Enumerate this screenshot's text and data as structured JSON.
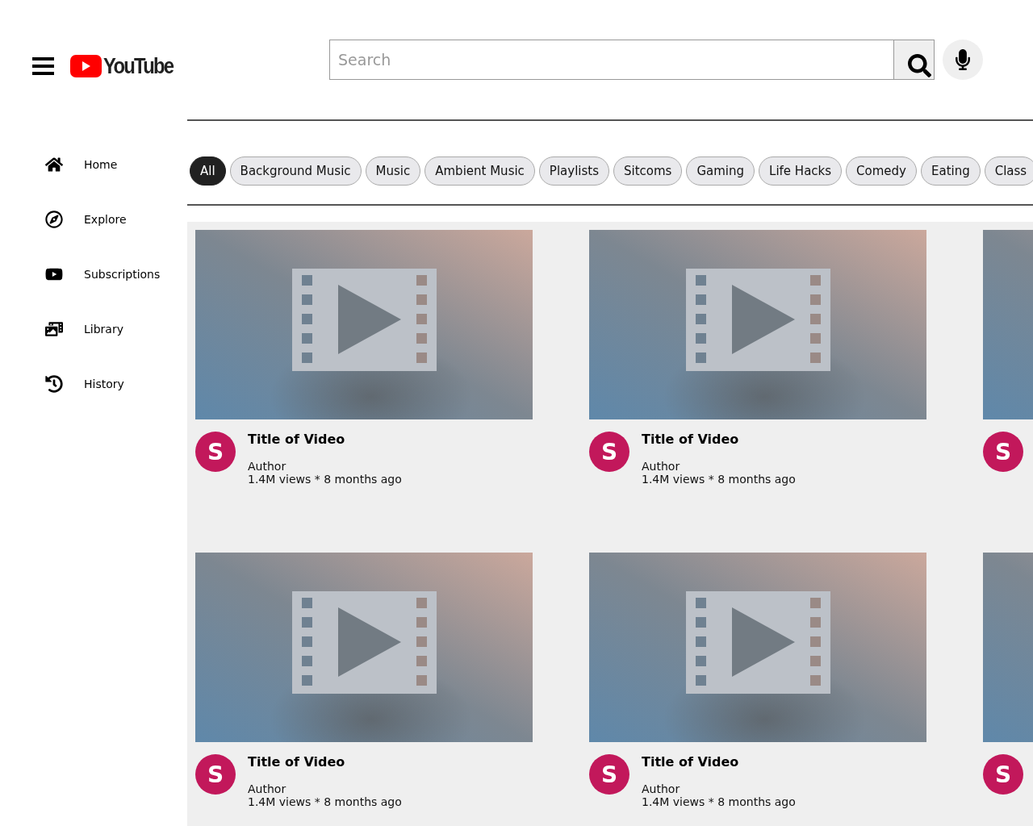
{
  "header": {
    "logo_text": "YouTube",
    "search": {
      "placeholder": "Search"
    }
  },
  "sidebar": {
    "items": [
      {
        "kind": "home",
        "label": "Home"
      },
      {
        "kind": "explore",
        "label": "Explore"
      },
      {
        "kind": "subscriptions",
        "label": "Subscriptions"
      },
      {
        "kind": "library",
        "label": "Library"
      },
      {
        "kind": "history",
        "label": "History"
      }
    ]
  },
  "chips": [
    {
      "label": "All",
      "selected": true
    },
    {
      "label": "Background Music",
      "selected": false
    },
    {
      "label": "Music",
      "selected": false
    },
    {
      "label": "Ambient Music",
      "selected": false
    },
    {
      "label": "Playlists",
      "selected": false
    },
    {
      "label": "Sitcoms",
      "selected": false
    },
    {
      "label": "Gaming",
      "selected": false
    },
    {
      "label": "Life Hacks",
      "selected": false
    },
    {
      "label": "Comedy",
      "selected": false
    },
    {
      "label": "Eating",
      "selected": false
    },
    {
      "label": "Class",
      "selected": false
    }
  ],
  "videos": [
    {
      "avatar": "S",
      "title": "Title of Video",
      "author": "Author",
      "meta": "1.4M views * 8 months ago"
    },
    {
      "avatar": "S",
      "title": "Title of Video",
      "author": "Author",
      "meta": "1.4M views * 8 months ago"
    },
    {
      "avatar": "S"
    },
    {
      "avatar": "S",
      "title": "Title of Video",
      "author": "Author",
      "meta": "1.4M views * 8 months ago"
    },
    {
      "avatar": "S",
      "title": "Title of Video",
      "author": "Author",
      "meta": "1.4M views * 8 months ago"
    },
    {
      "avatar": "S"
    }
  ]
}
